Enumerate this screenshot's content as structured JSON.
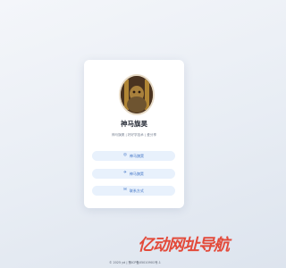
{
  "profile": {
    "name": "神马旗昊",
    "tagline": "神马旗昊 | 好好学技术 | 爱分享"
  },
  "links": [
    {
      "label": "神马旗昊",
      "icon": "github-icon",
      "glyph": "◎"
    },
    {
      "label": "神马旗昊",
      "icon": "bird-icon",
      "glyph": "✈"
    },
    {
      "label": "联系方式",
      "icon": "mail-icon",
      "glyph": "✉"
    }
  ],
  "watermark": "亿动网址导航",
  "footer": "© 2025 yd | 豫ICP备05010901号-1",
  "colors": {
    "accent": "#3a6fc4",
    "button_bg": "#e8f1fc",
    "brand": "#e34a3a"
  }
}
